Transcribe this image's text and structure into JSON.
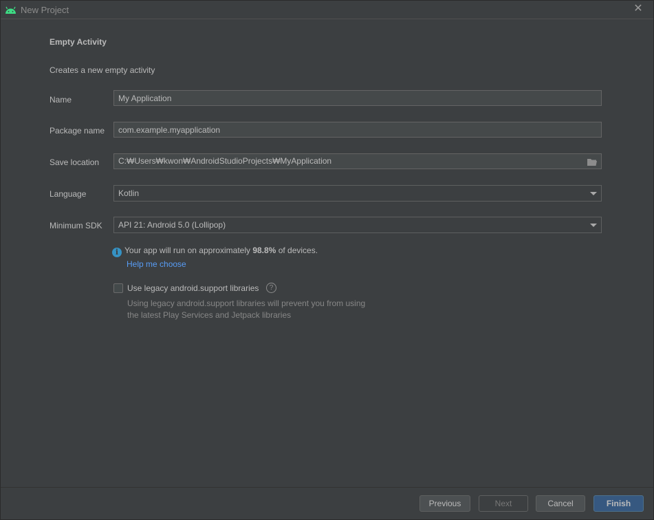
{
  "window": {
    "title": "New Project",
    "accent": "#3ddc84"
  },
  "page": {
    "heading": "Empty Activity",
    "description": "Creates a new empty activity"
  },
  "form": {
    "name": {
      "label": "Name",
      "value": "My Application"
    },
    "package": {
      "label": "Package name",
      "value": "com.example.myapplication"
    },
    "save_location": {
      "label": "Save location",
      "value": "C:₩Users₩kwon₩AndroidStudioProjects₩MyApplication"
    },
    "language": {
      "label": "Language",
      "value": "Kotlin"
    },
    "min_sdk": {
      "label": "Minimum SDK",
      "value": "API 21: Android 5.0 (Lollipop)"
    }
  },
  "info": {
    "prefix": "Your app will run on approximately ",
    "percent": "98.8%",
    "suffix": " of devices.",
    "help_link": "Help me choose"
  },
  "legacy": {
    "label": "Use legacy android.support libraries",
    "checked": false,
    "hint_line1": "Using legacy android.support libraries will prevent you from using",
    "hint_line2": "the latest Play Services and Jetpack libraries"
  },
  "buttons": {
    "previous": "Previous",
    "next": "Next",
    "cancel": "Cancel",
    "finish": "Finish"
  },
  "colors": {
    "background": "#3c3f41",
    "link": "#589df6",
    "info": "#3592c4",
    "primary_button": "#365880"
  }
}
